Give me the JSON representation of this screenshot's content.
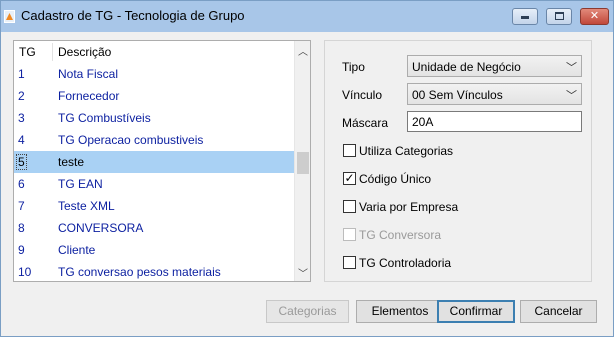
{
  "window": {
    "title": "Cadastro de TG - Tecnologia de Grupo"
  },
  "icons": {
    "app": "app-icon",
    "minimize": "minimize-icon",
    "maximize": "maximize-icon",
    "close": "close-icon"
  },
  "list": {
    "headers": {
      "tg": "TG",
      "descricao": "Descrição"
    },
    "selected_index": 4,
    "rows": [
      {
        "tg": "1",
        "descricao": "Nota Fiscal"
      },
      {
        "tg": "2",
        "descricao": "Fornecedor"
      },
      {
        "tg": "3",
        "descricao": "TG Combustíveis"
      },
      {
        "tg": "4",
        "descricao": "TG Operacao combustiveis"
      },
      {
        "tg": "5",
        "descricao": "teste"
      },
      {
        "tg": "6",
        "descricao": "TG EAN"
      },
      {
        "tg": "7",
        "descricao": "Teste XML"
      },
      {
        "tg": "8",
        "descricao": "CONVERSORA"
      },
      {
        "tg": "9",
        "descricao": "Cliente"
      },
      {
        "tg": "10",
        "descricao": "TG conversao pesos materiais"
      }
    ]
  },
  "form": {
    "tipo_label": "Tipo",
    "tipo_value": "Unidade de Negócio",
    "vinculo_label": "Vínculo",
    "vinculo_value": "00 Sem Vínculos",
    "mascara_label": "Máscara",
    "mascara_value": "20A",
    "checkboxes": [
      {
        "label": "Utiliza Categorias",
        "checked": false,
        "disabled": false
      },
      {
        "label": "Código Único",
        "checked": true,
        "disabled": false
      },
      {
        "label": "Varia por Empresa",
        "checked": false,
        "disabled": false
      },
      {
        "label": "TG Conversora",
        "checked": false,
        "disabled": true
      },
      {
        "label": "TG Controladoria",
        "checked": false,
        "disabled": false
      }
    ]
  },
  "buttons": {
    "categorias": "Categorias",
    "elementos": "Elementos",
    "confirmar": "Confirmar",
    "cancelar": "Cancelar"
  },
  "colors": {
    "titlebar": "#a8c6e8",
    "selection": "#a9d1f4",
    "list_text": "#0b1fa0",
    "close_button": "#c1483a"
  }
}
